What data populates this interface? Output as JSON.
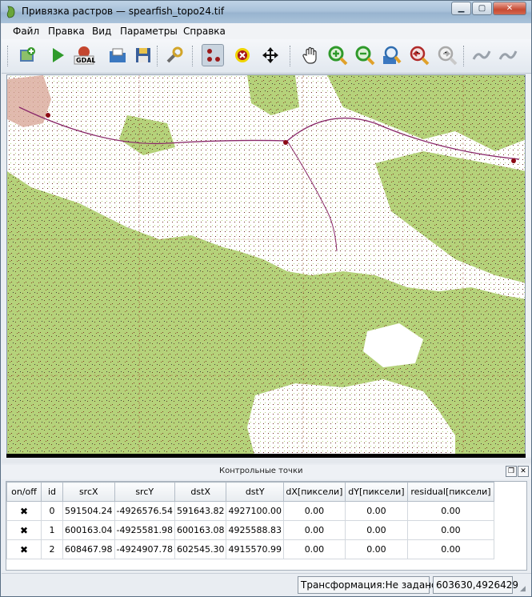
{
  "window": {
    "title": "Привязка растров — spearfish_topo24.tif"
  },
  "menu": [
    "Файл",
    "Правка",
    "Вид",
    "Параметры",
    "Справка"
  ],
  "toolbar": {
    "buttons": [
      {
        "name": "add-raster-icon"
      },
      {
        "name": "start-georeferencing-icon"
      },
      {
        "name": "gdal-script-icon"
      },
      {
        "name": "load-gcp-icon"
      },
      {
        "name": "save-gcp-icon"
      },
      {
        "name": "transform-settings-icon"
      },
      {
        "name": "add-point-icon"
      },
      {
        "name": "delete-point-icon"
      },
      {
        "name": "move-point-icon"
      },
      {
        "name": "pan-icon"
      },
      {
        "name": "zoom-in-icon"
      },
      {
        "name": "zoom-out-icon"
      },
      {
        "name": "zoom-layer-icon"
      },
      {
        "name": "zoom-last-icon"
      },
      {
        "name": "zoom-next-icon"
      },
      {
        "name": "link-georef-icon"
      },
      {
        "name": "link-qgis-icon"
      }
    ]
  },
  "dock": {
    "title": "Контрольные точки"
  },
  "gcp_table": {
    "headers": [
      "on/off",
      "id",
      "srcX",
      "srcY",
      "dstX",
      "dstY",
      "dX[пиксели]",
      "dY[пиксели]",
      "residual[пиксели]"
    ],
    "rows": [
      [
        "✖",
        "0",
        "591504.24",
        "-4926576.54",
        "591643.82",
        "4927100.00",
        "0.00",
        "0.00",
        "0.00"
      ],
      [
        "✖",
        "1",
        "600163.04",
        "-4925581.98",
        "600163.08",
        "4925588.83",
        "0.00",
        "0.00",
        "0.00"
      ],
      [
        "✖",
        "2",
        "608467.98",
        "-4924907.78",
        "602545.30",
        "4915570.99",
        "0.00",
        "0.00",
        "0.00"
      ]
    ]
  },
  "status": {
    "transform": "Трансформация:Не задано",
    "coords": "603630,4926429"
  },
  "colors": {
    "map_green": "#b5d27a",
    "gcp_marker": "#8c0a14",
    "road": "#8a2a6a"
  }
}
